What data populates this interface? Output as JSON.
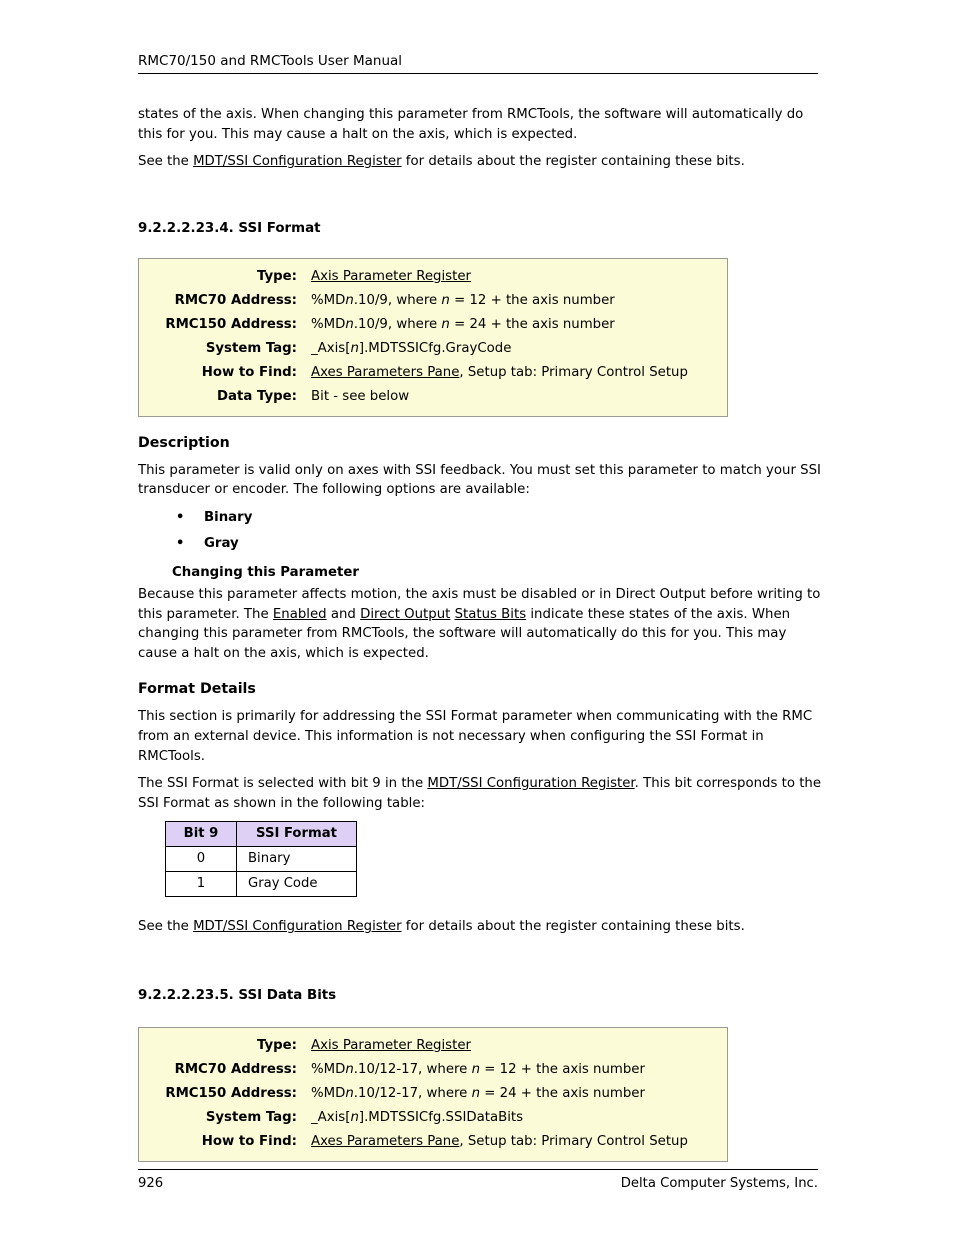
{
  "header": {
    "title": "RMC70/150 and RMCTools User Manual"
  },
  "top_paragraphs": {
    "p1_a": "states of the axis. When changing this parameter from RMCTools, the software will automatically do this for you. This may cause a halt on the axis, which is expected.",
    "p2_prefix": "See the ",
    "p2_link": "MDT/SSI Configuration Register",
    "p2_suffix": " for details about the register containing these bits."
  },
  "section_ssi_format": {
    "heading": "9.2.2.2.23.4. SSI Format",
    "param_box": {
      "rows": [
        {
          "label": "Type:",
          "value_link": "Axis Parameter Register",
          "value_rest": ""
        },
        {
          "label": "RMC70 Address:",
          "value_pre": "%MD",
          "value_italic": "n",
          "value_mid": ".10/9, where ",
          "value_italic2": "n",
          "value_post": " = 12 + the axis number"
        },
        {
          "label": "RMC150 Address:",
          "value_pre": "%MD",
          "value_italic": "n",
          "value_mid": ".10/9, where ",
          "value_italic2": "n",
          "value_post": " = 24 + the axis number"
        },
        {
          "label": "System Tag:",
          "value_pre": "_Axis[",
          "value_italic": "n",
          "value_post": "].MDTSSICfg.GrayCode"
        },
        {
          "label": "How to Find:",
          "value_link": "Axes Parameters Pane",
          "value_rest": ", Setup tab: Primary Control Setup"
        },
        {
          "label": "Data Type:",
          "value_plain": "Bit - see below"
        }
      ]
    },
    "description": {
      "heading": "Description",
      "intro": "This parameter is valid only on axes with SSI feedback. You must set this parameter to match your SSI transducer or encoder. The following options are available:",
      "options": [
        "Binary",
        "Gray"
      ],
      "changing_heading": "Changing this Parameter",
      "changing_p1": "Because this parameter affects motion, the axis must be disabled or in Direct Output before writing to this parameter. The ",
      "changing_link1": "Enabled",
      "changing_p2": " and ",
      "changing_link2": "Direct Output",
      "changing_p3": " ",
      "changing_link3": "Status Bits",
      "changing_p4": " indicate these states of the axis. When changing this parameter from RMCTools, the software will automatically do this for you. This may cause a halt on the axis, which is expected."
    },
    "format_details": {
      "heading": "Format Details",
      "p1": "This section is primarily for addressing the SSI Format parameter when communicating with the RMC from an external device. This information is not necessary when configuring the SSI Format in RMCTools.",
      "p2_prefix": "The SSI Format is selected with bit 9 in the ",
      "p2_link": "MDT/SSI Configuration Register",
      "p2_suffix": ". This bit corresponds to the SSI Format as shown in the following table:",
      "table": {
        "columns": [
          "Bit 9",
          "SSI Format"
        ],
        "rows": [
          [
            "0",
            "Binary"
          ],
          [
            "1",
            "Gray Code"
          ]
        ]
      },
      "p3_prefix": "See the ",
      "p3_link": "MDT/SSI Configuration Register",
      "p3_suffix": " for details about the register containing these bits."
    }
  },
  "section_ssi_data_bits": {
    "heading": "9.2.2.2.23.5. SSI Data Bits",
    "param_box": {
      "rows": [
        {
          "label": "Type:",
          "value_link": "Axis Parameter Register",
          "value_rest": ""
        },
        {
          "label": "RMC70 Address:",
          "value_pre": "%MD",
          "value_italic": "n",
          "value_mid": ".10/12-17, where ",
          "value_italic2": "n",
          "value_post": " = 12 + the axis number"
        },
        {
          "label": "RMC150 Address:",
          "value_pre": "%MD",
          "value_italic": "n",
          "value_mid": ".10/12-17, where ",
          "value_italic2": "n",
          "value_post": " = 24 + the axis number"
        },
        {
          "label": "System Tag:",
          "value_pre": "_Axis[",
          "value_italic": "n",
          "value_post": "].MDTSSICfg.SSIDataBits"
        },
        {
          "label": "How to Find:",
          "value_link": "Axes Parameters Pane",
          "value_rest": ", Setup tab: Primary Control Setup"
        }
      ]
    }
  },
  "footer": {
    "page_number": "926",
    "company": "Delta Computer Systems, Inc."
  },
  "colors": {
    "param_box_bg": "#fbfbd8",
    "param_box_border": "#9a9a92",
    "table_header_bg": "#ddd0f4",
    "text": "#000000"
  }
}
